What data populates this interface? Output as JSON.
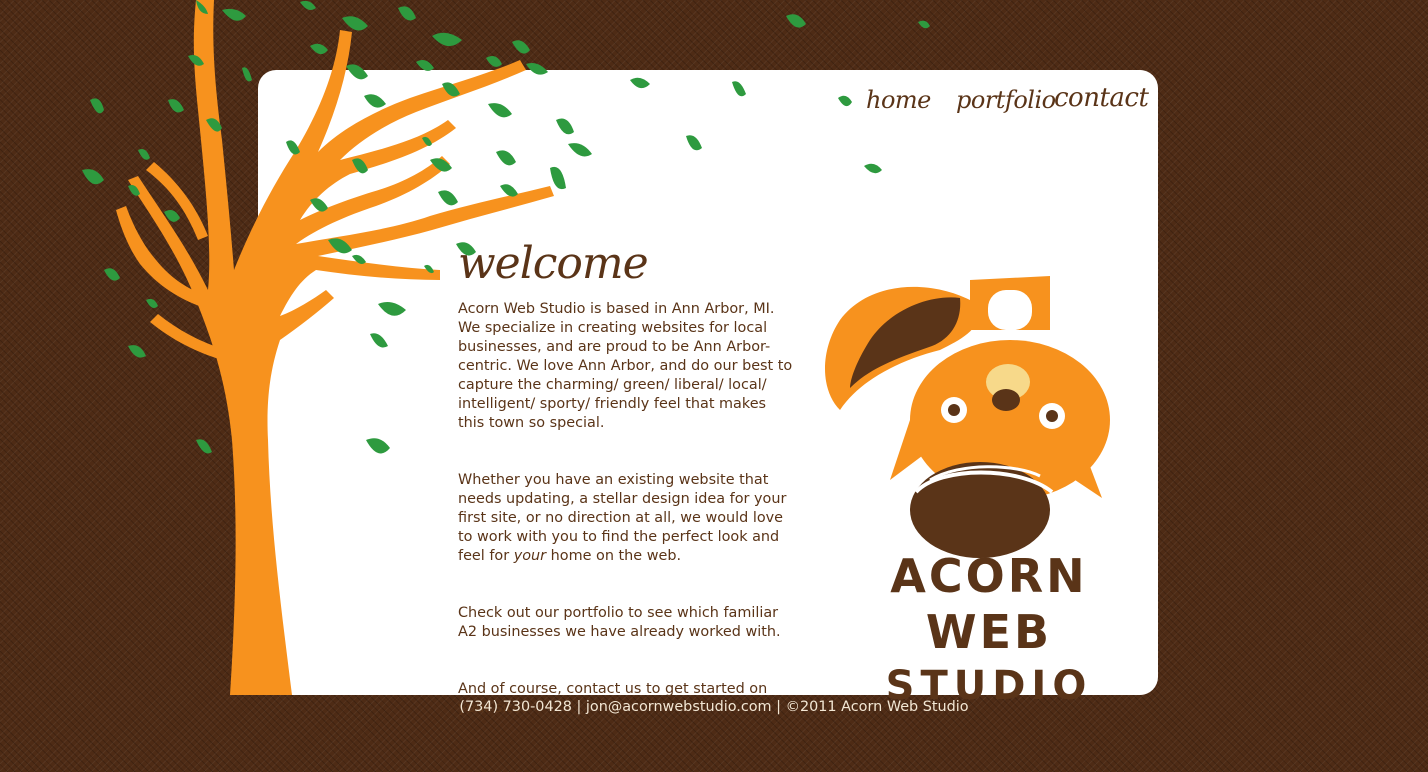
{
  "nav": {
    "items": [
      {
        "label": "home"
      },
      {
        "label": "portfolio"
      },
      {
        "label": "contact"
      }
    ]
  },
  "main": {
    "heading": "welcome",
    "paragraphs": [
      "Acorn Web Studio is based in Ann Arbor, MI. We specialize in creating websites for local businesses, and are proud to be Ann Arbor-centric. We love Ann Arbor, and do our best to capture the charming/ green/ liberal/ local/ intelligent/ sporty/ friendly feel that makes this town so special.",
      {
        "before": "Whether you have an existing website that needs updating, a stellar design idea for your first site, or no direction at all, we would love to work with you to find the perfect look and feel for ",
        "em": "your",
        "after": " home on the web."
      },
      "Check out our portfolio to see which familiar A2 businesses we have already worked with.",
      "And of course, contact us to get started on your site!"
    ]
  },
  "logo": {
    "line1": "ACORN WEB",
    "line2": "STUDIO"
  },
  "footer": {
    "text": "(734) 730-0428 | jon@acornwebstudio.com | ©2011 Acorn Web Studio"
  },
  "colors": {
    "background": "#4e2b15",
    "panel": "#ffffff",
    "text_brown": "#5a3418",
    "tree_orange": "#f7921e",
    "leaf_green": "#2e9a3f"
  }
}
